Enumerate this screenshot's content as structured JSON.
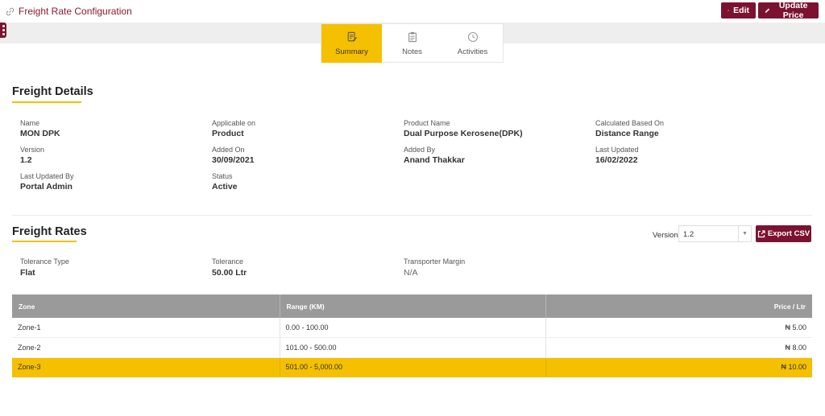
{
  "header": {
    "title": "Freight Rate Configuration",
    "edit_label": "Edit",
    "update_price_label": "Update Price"
  },
  "tabs": [
    {
      "label": "Summary",
      "icon": "summary-doc-icon",
      "active": true
    },
    {
      "label": "Notes",
      "icon": "notes-clipboard-icon",
      "active": false
    },
    {
      "label": "Activities",
      "icon": "activities-clock-icon",
      "active": false
    }
  ],
  "freight_details": {
    "title": "Freight Details",
    "fields": [
      {
        "label": "Name",
        "value": "MON DPK"
      },
      {
        "label": "Applicable on",
        "value": "Product"
      },
      {
        "label": "Product Name",
        "value": "Dual Purpose Kerosene(DPK)"
      },
      {
        "label": "Calculated Based On",
        "value": "Distance Range"
      },
      {
        "label": "Version",
        "value": "1.2"
      },
      {
        "label": "Added On",
        "value": "30/09/2021"
      },
      {
        "label": "Added By",
        "value": "Anand Thakkar"
      },
      {
        "label": "Last Updated",
        "value": "16/02/2022"
      },
      {
        "label": "Last Updated By",
        "value": "Portal Admin"
      },
      {
        "label": "Status",
        "value": "Active"
      }
    ]
  },
  "freight_rates": {
    "title": "Freight Rates",
    "version_label": "Version",
    "version_value": "1.2",
    "export_label": "Export CSV",
    "fields": [
      {
        "label": "Tolerance Type",
        "value": "Flat"
      },
      {
        "label": "Tolerance",
        "value": "50.00 Ltr"
      },
      {
        "label": "Transporter Margin",
        "value": "N/A"
      }
    ],
    "columns": [
      "Zone",
      "Range (KM)",
      "Price / Ltr"
    ],
    "rows": [
      {
        "zone": "Zone-1",
        "range": "0.00 - 100.00",
        "price": "₦ 5.00",
        "highlighted": false
      },
      {
        "zone": "Zone-2",
        "range": "101.00 - 500.00",
        "price": "₦ 8.00",
        "highlighted": false
      },
      {
        "zone": "Zone-3",
        "range": "501.00 - 5,000.00",
        "price": "₦ 10.00",
        "highlighted": true
      }
    ]
  },
  "colors": {
    "brand": "#7b1330",
    "accent": "#f5c000",
    "header_gray": "#9a9a9a"
  }
}
